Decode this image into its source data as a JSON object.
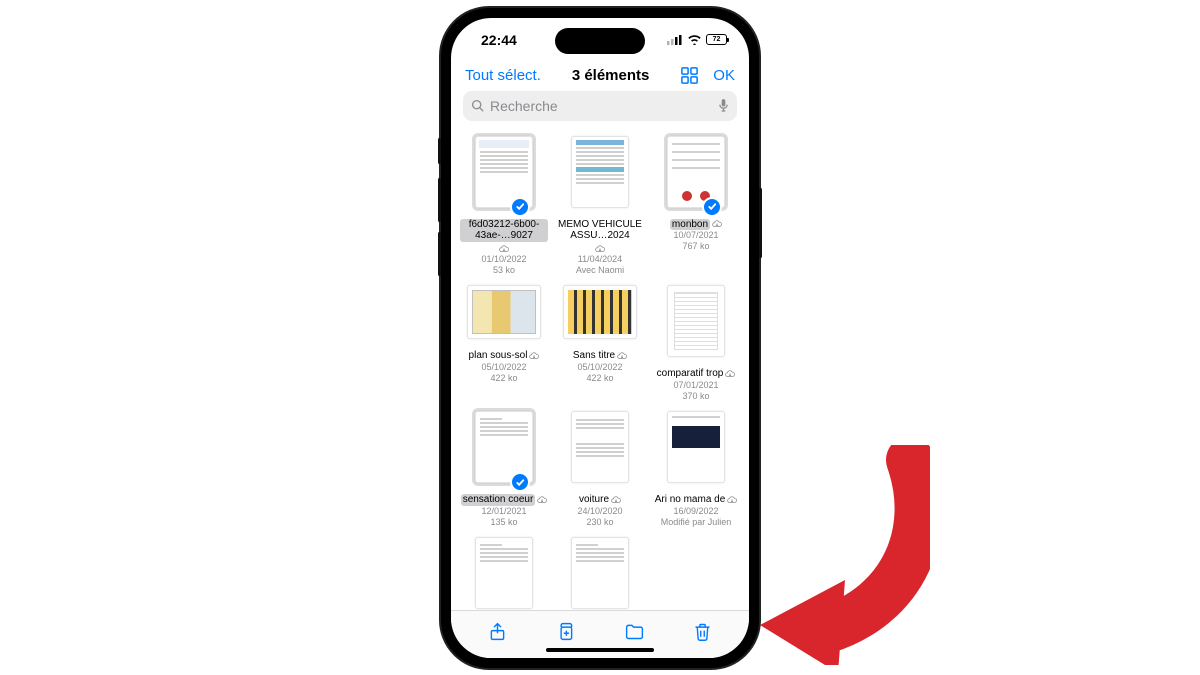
{
  "status": {
    "time": "22:44",
    "battery": "72"
  },
  "nav": {
    "select_all": "Tout sélect.",
    "title": "3 éléments",
    "ok": "OK"
  },
  "search": {
    "placeholder": "Recherche"
  },
  "files": [
    {
      "name": "f6d03212-6b00-43ae-…9027",
      "date": "01/10/2022",
      "size": "53 ko",
      "selected": true,
      "thumb": "doc"
    },
    {
      "name": "MEMO VEHICULE ASSU…2024",
      "date": "11/04/2024",
      "extra": "Avec Naomi",
      "selected": false,
      "thumb": "memo"
    },
    {
      "name": "monbon",
      "date": "10/07/2021",
      "size": "767 ko",
      "selected": true,
      "thumb": "reddots"
    },
    {
      "name": "plan sous-sol",
      "date": "05/10/2022",
      "size": "422 ko",
      "selected": false,
      "thumb": "plan",
      "landscape": true
    },
    {
      "name": "Sans titre",
      "date": "05/10/2022",
      "size": "422 ko",
      "selected": false,
      "thumb": "plan2",
      "landscape": true
    },
    {
      "name": "comparatif trop",
      "date": "07/01/2021",
      "size": "370 ko",
      "selected": false,
      "thumb": "table"
    },
    {
      "name": "sensation coeur",
      "date": "12/01/2021",
      "size": "135 ko",
      "selected": true,
      "thumb": "blank"
    },
    {
      "name": "voiture",
      "date": "24/10/2020",
      "size": "230 ko",
      "selected": false,
      "thumb": "lines"
    },
    {
      "name": "Ari no mama de",
      "date": "16/09/2022",
      "extra": "Modifié par Julien",
      "selected": false,
      "thumb": "dark"
    },
    {
      "name": "",
      "thumb": "blank2",
      "partial": true
    },
    {
      "name": "",
      "thumb": "blank2",
      "partial": true
    },
    {
      "name": "",
      "thumb": "",
      "partial": true,
      "empty": true
    }
  ]
}
